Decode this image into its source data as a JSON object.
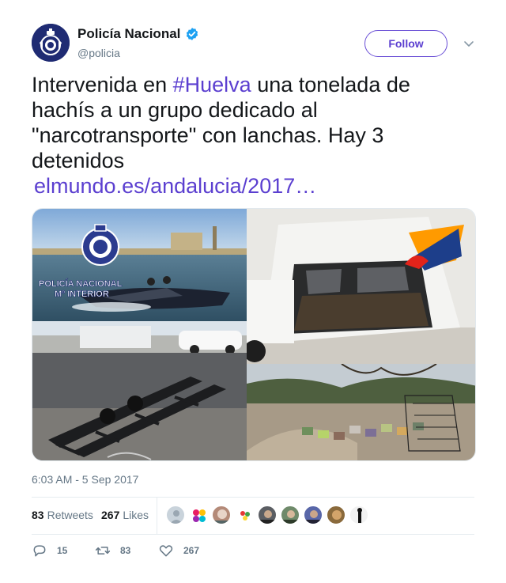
{
  "author": {
    "display_name": "Policía Nacional",
    "handle": "@policia",
    "verified": true,
    "avatar_icon": "police-badge-icon"
  },
  "follow_button": {
    "label": "Follow"
  },
  "tweet": {
    "text_before": "Intervenida en ",
    "hashtag": "#Huelva",
    "text_after": " una tonelada de hachís a un grupo dedicado al \"narcotransporte\" con lanchas. Hay 3 detenidos",
    "link": "elmundo.es/andalucia/2017…"
  },
  "media": {
    "tile1_caption_line1": "POLICÍA NACIONAL",
    "tile1_caption_line2": "Mº INTERIOR"
  },
  "timestamp": "6:03 AM - 5 Sep 2017",
  "stats": {
    "retweets_count": "83",
    "retweets_label": "Retweets",
    "likes_count": "267",
    "likes_label": "Likes"
  },
  "actions": {
    "reply_count": "15",
    "retweet_count": "83",
    "like_count": "267"
  },
  "colors": {
    "accent": "#5b3fd0",
    "verified": "#1da1f2",
    "muted": "#657786"
  }
}
